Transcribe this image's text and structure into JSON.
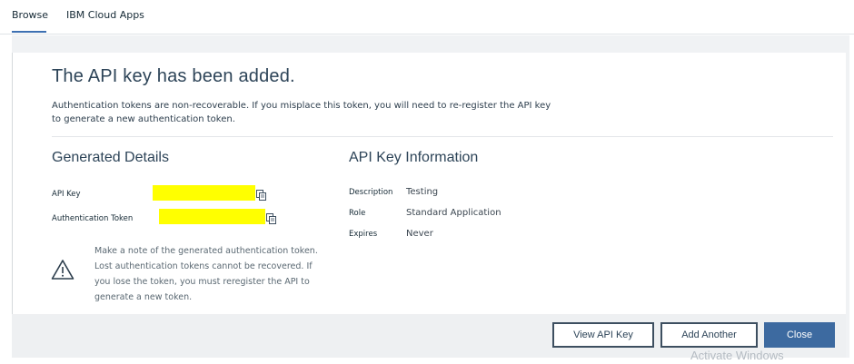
{
  "tabs": [
    {
      "label": "Browse",
      "active": true
    },
    {
      "label": "IBM Cloud Apps",
      "active": false
    }
  ],
  "modal": {
    "title": "The API key has been added.",
    "description": "Authentication tokens are non-recoverable. If you misplace this token, you will need to re-register the API key to generate a new authentication token.",
    "generated": {
      "heading": "Generated Details",
      "api_key_label": "API Key",
      "token_label": "Authentication Token",
      "api_key_value": "",
      "token_value": "",
      "redaction_color": "#ffff00"
    },
    "info": {
      "heading": "API Key Information",
      "rows": [
        {
          "label": "Description",
          "value": "Testing"
        },
        {
          "label": "Role",
          "value": "Standard Application"
        },
        {
          "label": "Expires",
          "value": "Never"
        }
      ]
    },
    "warning": "Make a note of the generated authentication token. Lost authentication tokens cannot be recovered. If you lose the token, you must reregister the API to generate a new token.",
    "buttons": {
      "view_api_key": "View API Key",
      "add_another": "Add Another",
      "close": "Close"
    }
  },
  "watermark": "Activate Windows",
  "colors": {
    "accent": "#3d70b2",
    "primary_button": "#3d6aa0",
    "heading": "#2d4458"
  }
}
